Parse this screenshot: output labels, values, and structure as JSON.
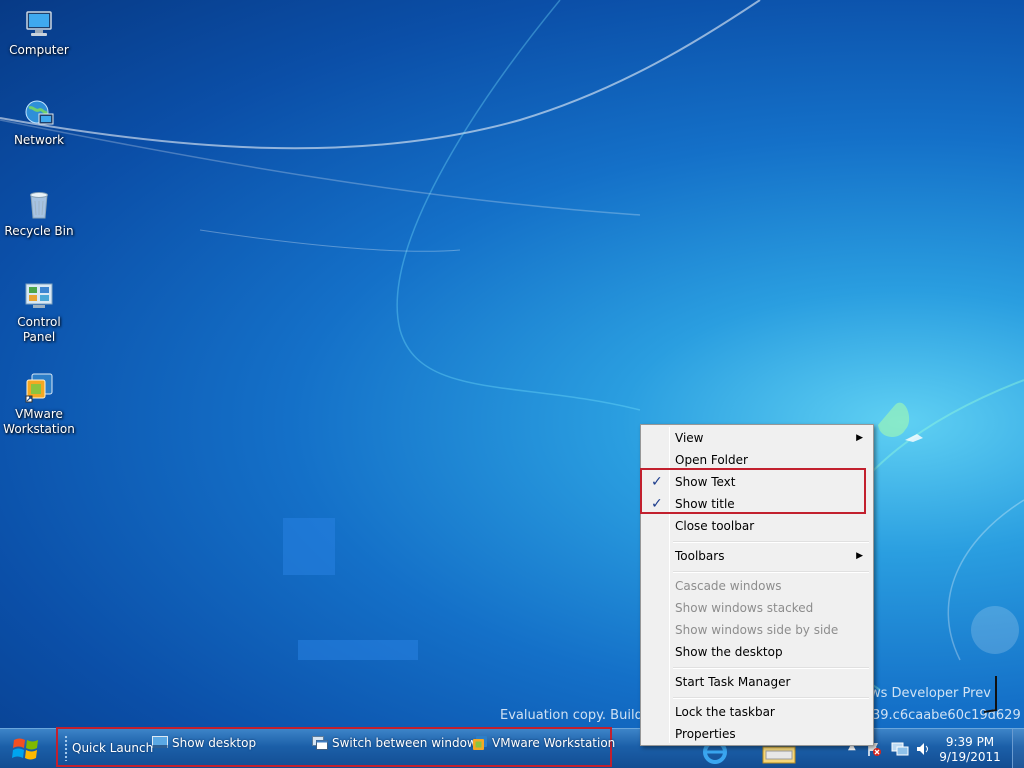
{
  "desktop": {
    "icons": [
      {
        "label": "Computer",
        "icon": "computer-icon"
      },
      {
        "label": "Network",
        "icon": "network-icon"
      },
      {
        "label": "Recycle Bin",
        "icon": "recycle-bin-icon"
      },
      {
        "label": "Control Panel",
        "icon": "control-panel-icon"
      },
      {
        "label": "VMware\nWorkstation",
        "icon": "vmware-icon"
      }
    ],
    "watermark": {
      "line1": "ws Developer Prev",
      "line2_left": "Evaluation copy. Build",
      "line2_right": "39.c6caabe60c19d629"
    }
  },
  "context_menu": {
    "items": [
      {
        "label": "View",
        "submenu": true
      },
      {
        "label": "Open Folder"
      },
      {
        "label": "Show Text",
        "checked": true
      },
      {
        "label": "Show title",
        "checked": true
      },
      {
        "label": "Close toolbar"
      },
      {
        "label": "Toolbars",
        "submenu": true
      },
      {
        "label": "Cascade windows",
        "disabled": true
      },
      {
        "label": "Show windows stacked",
        "disabled": true
      },
      {
        "label": "Show windows side by side",
        "disabled": true
      },
      {
        "label": "Show the desktop"
      },
      {
        "label": "Start Task Manager"
      },
      {
        "label": "Lock the taskbar"
      },
      {
        "label": "Properties"
      }
    ]
  },
  "taskbar": {
    "toolbar_title": "Quick Launch",
    "toolbar_items": [
      {
        "label": "Show desktop"
      },
      {
        "label": "Switch between windows"
      },
      {
        "label": "VMware Workstation"
      }
    ],
    "clock": {
      "time": "9:39 PM",
      "date": "9/19/2011"
    }
  }
}
